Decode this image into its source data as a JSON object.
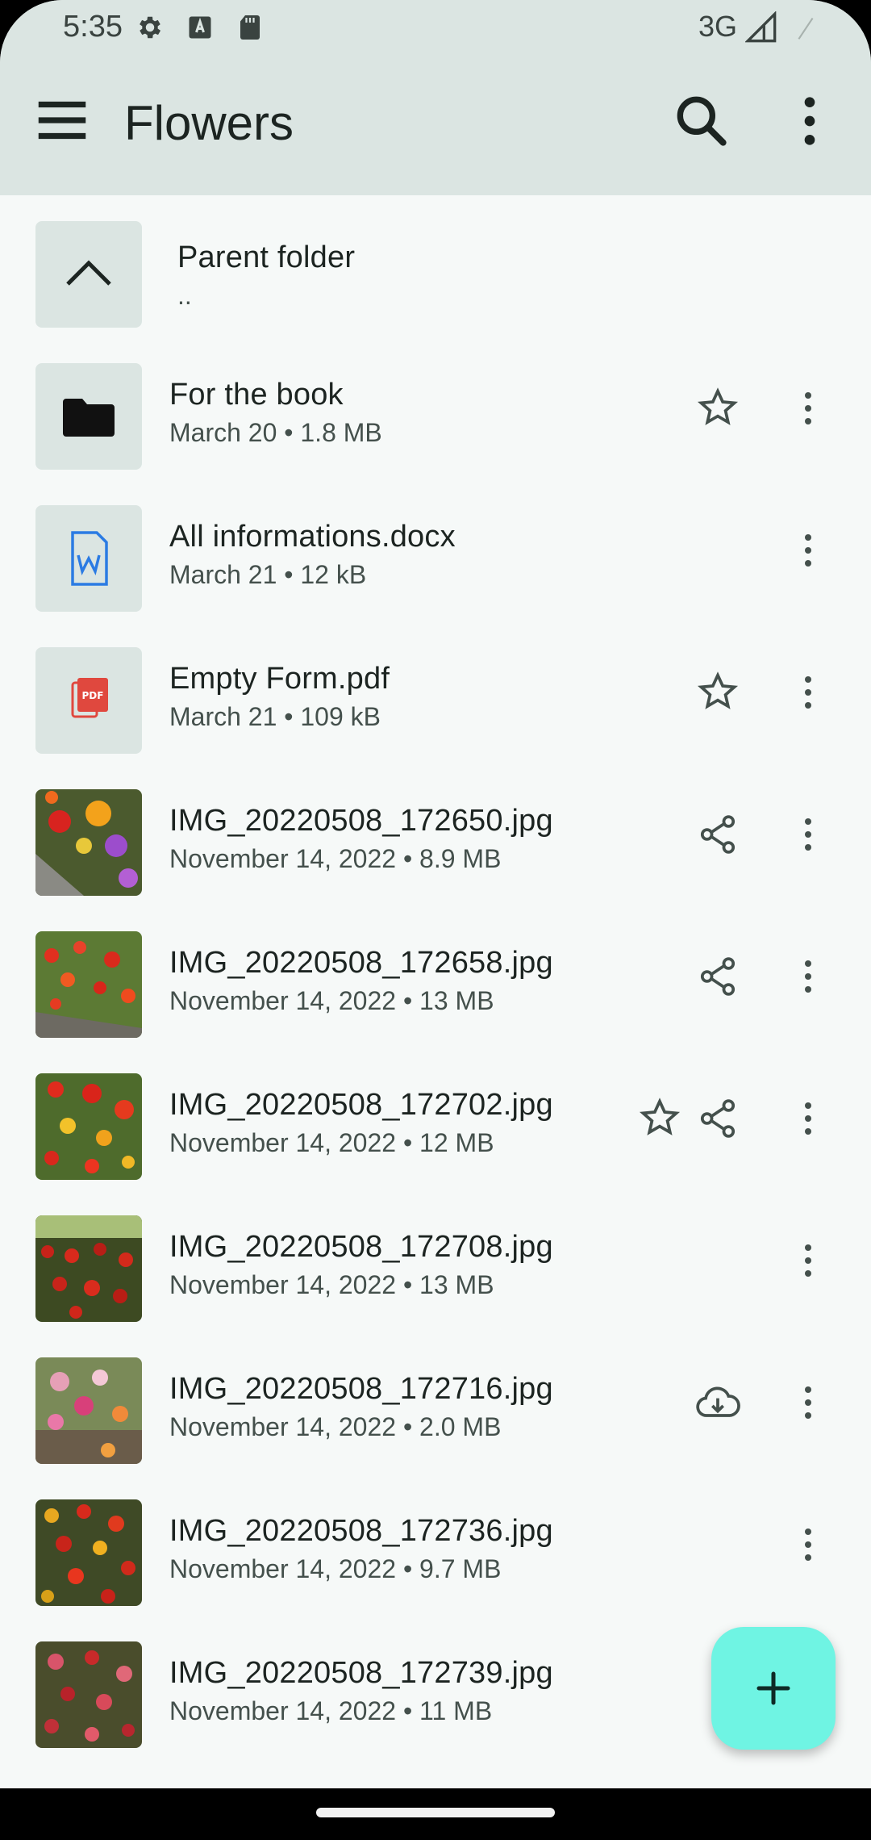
{
  "status": {
    "time": "5:35",
    "network": "3G"
  },
  "appbar": {
    "title": "Flowers"
  },
  "parent": {
    "name": "Parent folder",
    "meta": ".."
  },
  "items": [
    {
      "name": "For the book",
      "meta": "March 20 • 1.8 MB"
    },
    {
      "name": "All informations.docx",
      "meta": "March 21 • 12 kB"
    },
    {
      "name": "Empty Form.pdf",
      "meta": "March 21 • 109 kB"
    },
    {
      "name": "IMG_20220508_172650.jpg",
      "meta": "November 14, 2022 • 8.9 MB"
    },
    {
      "name": "IMG_20220508_172658.jpg",
      "meta": "November 14, 2022 • 13 MB"
    },
    {
      "name": "IMG_20220508_172702.jpg",
      "meta": "November 14, 2022 • 12 MB"
    },
    {
      "name": "IMG_20220508_172708.jpg",
      "meta": "November 14, 2022 • 13 MB"
    },
    {
      "name": "IMG_20220508_172716.jpg",
      "meta": "November 14, 2022 • 2.0 MB"
    },
    {
      "name": "IMG_20220508_172736.jpg",
      "meta": "November 14, 2022 • 9.7 MB"
    },
    {
      "name": "IMG_20220508_172739.jpg",
      "meta": "November 14, 2022 • 11 MB"
    }
  ],
  "colors": {
    "appbar": "#dbe5e2",
    "fab": "#6ff4e3",
    "icon": "#44504c"
  }
}
